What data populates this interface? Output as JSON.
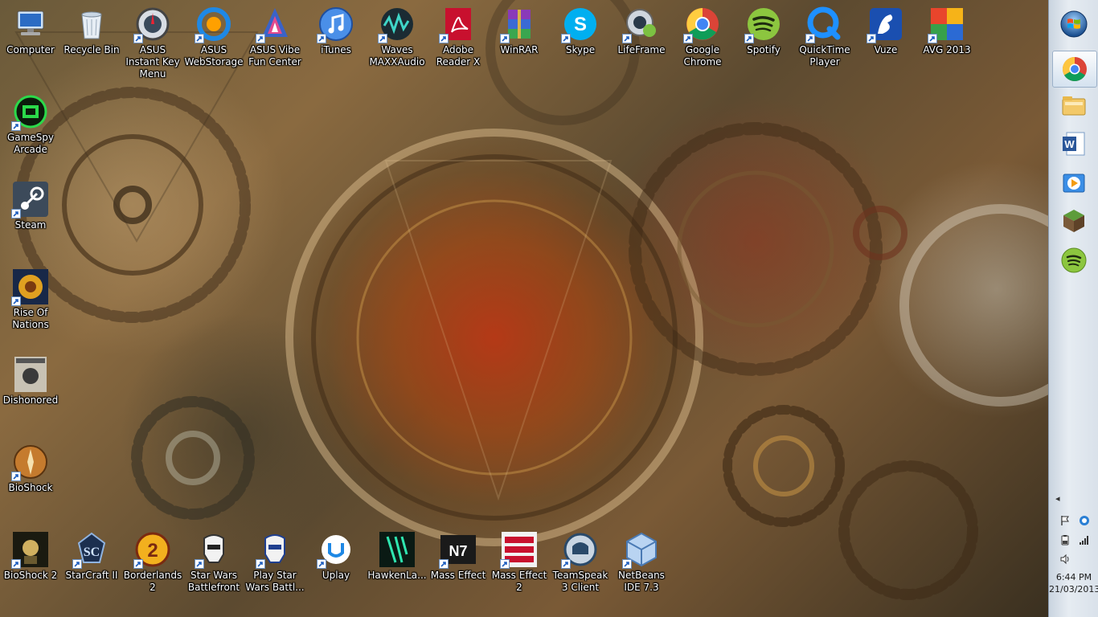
{
  "desktop": {
    "icons": [
      {
        "label": "Computer",
        "icon": "computer-icon",
        "shortcut": false
      },
      {
        "label": "Recycle Bin",
        "icon": "recycle-bin-icon",
        "shortcut": false
      },
      {
        "label": "ASUS Instant Key Menu",
        "icon": "asus-instant-key-icon",
        "shortcut": true
      },
      {
        "label": "ASUS WebStorage",
        "icon": "asus-webstorage-icon",
        "shortcut": true
      },
      {
        "label": "ASUS Vibe Fun Center",
        "icon": "asus-vibe-icon",
        "shortcut": true
      },
      {
        "label": "iTunes",
        "icon": "itunes-icon",
        "shortcut": true
      },
      {
        "label": "Waves MAXXAudio",
        "icon": "waves-icon",
        "shortcut": true
      },
      {
        "label": "Adobe Reader X",
        "icon": "adobe-reader-icon",
        "shortcut": true
      },
      {
        "label": "WinRAR",
        "icon": "winrar-icon",
        "shortcut": true
      },
      {
        "label": "Skype",
        "icon": "skype-icon",
        "shortcut": true
      },
      {
        "label": "LifeFrame",
        "icon": "lifeframe-icon",
        "shortcut": true
      },
      {
        "label": "Google Chrome",
        "icon": "chrome-icon",
        "shortcut": true
      },
      {
        "label": "Spotify",
        "icon": "spotify-icon",
        "shortcut": true
      },
      {
        "label": "QuickTime Player",
        "icon": "quicktime-icon",
        "shortcut": true
      },
      {
        "label": "Vuze",
        "icon": "vuze-icon",
        "shortcut": true
      },
      {
        "label": "AVG 2013",
        "icon": "avg-icon",
        "shortcut": true
      },
      {
        "label": "GameSpy Arcade",
        "icon": "gamespy-icon",
        "shortcut": true
      },
      {
        "label": "Steam",
        "icon": "steam-icon",
        "shortcut": true
      },
      {
        "label": "Rise Of Nations",
        "icon": "rise-of-nations-icon",
        "shortcut": true
      },
      {
        "label": "Dishonored",
        "icon": "dishonored-icon",
        "shortcut": false
      },
      {
        "label": "BioShock",
        "icon": "bioshock-icon",
        "shortcut": true
      },
      {
        "label": "BioShock 2",
        "icon": "bioshock2-icon",
        "shortcut": true
      },
      {
        "label": "StarCraft II",
        "icon": "starcraft2-icon",
        "shortcut": true
      },
      {
        "label": "Borderlands 2",
        "icon": "borderlands2-icon",
        "shortcut": true
      },
      {
        "label": "Star Wars Battlefront",
        "icon": "star-wars-battlefront-icon",
        "shortcut": true
      },
      {
        "label": "Play Star Wars Battl...",
        "icon": "star-wars-battlefront2-icon",
        "shortcut": true
      },
      {
        "label": "Uplay",
        "icon": "uplay-icon",
        "shortcut": true
      },
      {
        "label": "HawkenLa...",
        "icon": "hawken-icon",
        "shortcut": false
      },
      {
        "label": "Mass Effect",
        "icon": "mass-effect-icon",
        "shortcut": true
      },
      {
        "label": "Mass Effect 2",
        "icon": "mass-effect2-icon",
        "shortcut": true
      },
      {
        "label": "TeamSpeak 3 Client",
        "icon": "teamspeak-icon",
        "shortcut": true
      },
      {
        "label": "NetBeans IDE 7.3",
        "icon": "netbeans-icon",
        "shortcut": true
      }
    ]
  },
  "taskbar": {
    "start": "windows-start-icon",
    "pinned": [
      "chrome-icon",
      "file-explorer-icon",
      "word-icon",
      "media-player-icon",
      "minecraft-icon",
      "spotify-icon"
    ],
    "tray": {
      "expand": "◂",
      "icons": [
        "flag-icon",
        "network-tray-icon",
        "battery-icon",
        "signal-icon",
        "volume-icon"
      ]
    },
    "clock": {
      "time": "6:44 PM",
      "date": "21/03/2013"
    }
  }
}
